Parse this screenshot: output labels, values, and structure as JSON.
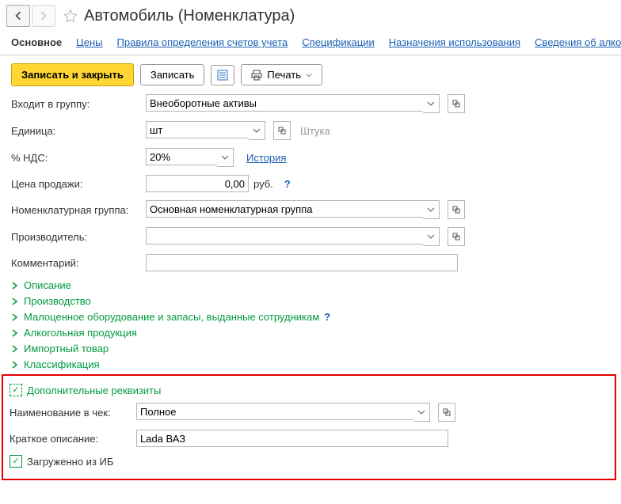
{
  "header": {
    "title": "Автомобиль (Номенклатура)"
  },
  "tabs": [
    "Основное",
    "Цены",
    "Правила определения счетов учета",
    "Спецификации",
    "Назначения использования",
    "Сведения об алко"
  ],
  "toolbar": {
    "save_close": "Записать и закрыть",
    "save": "Записать",
    "print": "Печать"
  },
  "form": {
    "group_label": "Входит в группу:",
    "group_value": "Внеоборотные активы",
    "unit_label": "Единица:",
    "unit_value": "шт",
    "unit_hint": "Штука",
    "vat_label": "% НДС:",
    "vat_value": "20%",
    "vat_history": "История",
    "price_label": "Цена продажи:",
    "price_value": "0,00",
    "price_currency": "руб.",
    "nomgroup_label": "Номенклатурная группа:",
    "nomgroup_value": "Основная номенклатурная группа",
    "manuf_label": "Производитель:",
    "manuf_value": "",
    "comment_label": "Комментарий:",
    "comment_value": ""
  },
  "expanders": [
    "Описание",
    "Производство",
    "Малоценное оборудование и запасы, выданные сотрудникам",
    "Алкогольная продукция",
    "Импортный товар",
    "Классификация"
  ],
  "extra": {
    "section": "Дополнительные реквизиты",
    "name_label": "Наименование в чек:",
    "name_value": "Полное",
    "short_label": "Краткое описание:",
    "short_value": "Lada ВАЗ",
    "loaded_label": "Загруженно из ИБ"
  }
}
